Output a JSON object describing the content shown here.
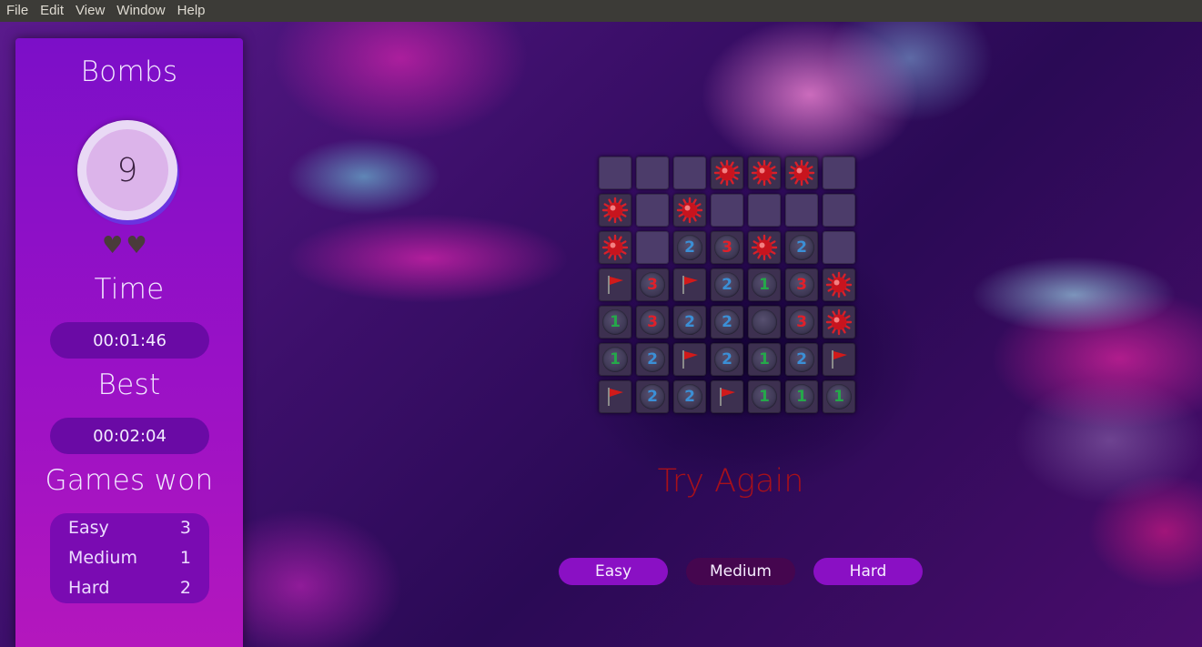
{
  "menubar": {
    "items": [
      {
        "label": "File"
      },
      {
        "label": "Edit"
      },
      {
        "label": "View"
      },
      {
        "label": "Window"
      },
      {
        "label": "Help"
      }
    ]
  },
  "sidebar": {
    "bombs_heading": "Bombs",
    "bombs_remaining": "9",
    "lives": 2,
    "time_heading": "Time",
    "time_value": "00:01:46",
    "best_heading": "Best",
    "best_value": "00:02:04",
    "games_won_heading": "Games won",
    "games_won": [
      {
        "label": "Easy",
        "count": "3"
      },
      {
        "label": "Medium",
        "count": "1"
      },
      {
        "label": "Hard",
        "count": "2"
      }
    ]
  },
  "board": {
    "rows": 7,
    "cols": 7,
    "legend": "H = hidden, M = mine, F = flag, 0 = empty revealed, digits = adjacent count",
    "cells": [
      [
        "H",
        "H",
        "H",
        "M",
        "M",
        "M",
        "H"
      ],
      [
        "M",
        "H",
        "M",
        "H",
        "H",
        "H",
        "H"
      ],
      [
        "M",
        "H",
        "2",
        "3",
        "M",
        "2",
        "H"
      ],
      [
        "F",
        "3",
        "F",
        "2",
        "1",
        "3",
        "M"
      ],
      [
        "1",
        "3",
        "2",
        "2",
        "0",
        "3",
        "M"
      ],
      [
        "1",
        "2",
        "F",
        "2",
        "1",
        "2",
        "F"
      ],
      [
        "F",
        "2",
        "2",
        "F",
        "1",
        "1",
        "1"
      ]
    ]
  },
  "status": {
    "message": "Try Again"
  },
  "difficulty": {
    "buttons": [
      {
        "label": "Easy",
        "state": "active"
      },
      {
        "label": "Medium",
        "state": "current"
      },
      {
        "label": "Hard",
        "state": "active"
      }
    ]
  },
  "colors": {
    "number_1": "#25a84a",
    "number_2": "#3b8fd6",
    "number_3": "#e0202a",
    "status_text": "#a8101a",
    "button": "#8a10c4",
    "button_selected": "#45064f"
  }
}
